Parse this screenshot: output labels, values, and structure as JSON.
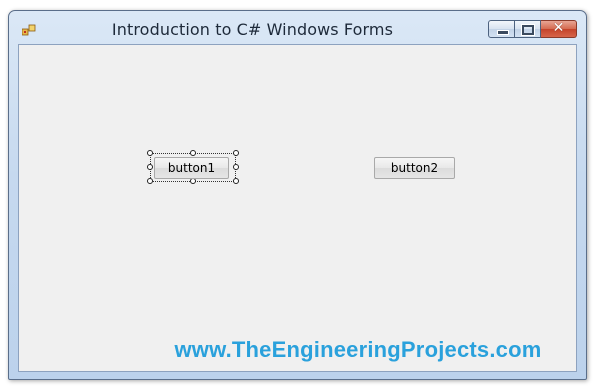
{
  "window": {
    "title": "Introduction to C# Windows Forms",
    "icon": "winforms-app-icon"
  },
  "caption_buttons": {
    "minimize_icon": "minimize-icon",
    "maximize_icon": "maximize-icon",
    "close_icon": "close-icon",
    "close_glyph": "✕"
  },
  "form": {
    "buttons": [
      {
        "label": "button1",
        "selected": true
      },
      {
        "label": "button2",
        "selected": false
      }
    ]
  },
  "watermark": {
    "text": "www.TheEngineeringProjects.com"
  },
  "colors": {
    "title_bar": "#c6d9ef",
    "client_area": "#f0f0f0",
    "close_button": "#c4432a",
    "watermark": "#2aa1dc"
  }
}
